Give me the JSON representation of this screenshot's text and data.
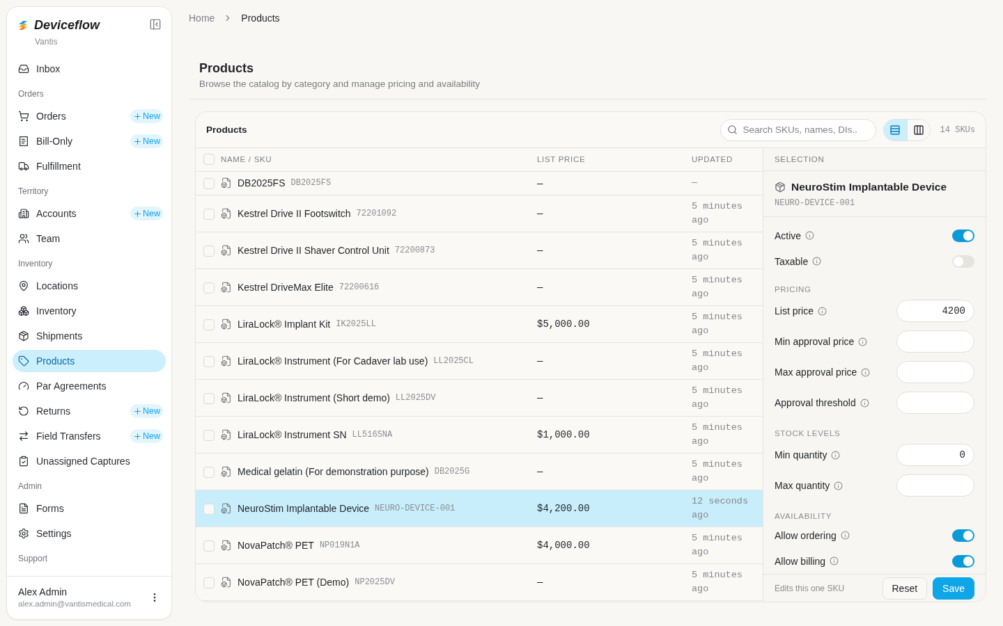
{
  "sidebar": {
    "brand": "Deviceflow",
    "org": "Vantis",
    "nav": [
      {
        "kind": "item",
        "label": "Inbox",
        "selected": false
      },
      {
        "kind": "section",
        "label": "Orders"
      },
      {
        "kind": "item",
        "label": "Orders",
        "badge": "New",
        "selected": false
      },
      {
        "kind": "item",
        "label": "Bill-Only",
        "badge": "New",
        "selected": false
      },
      {
        "kind": "item",
        "label": "Fulfillment",
        "selected": false
      },
      {
        "kind": "section",
        "label": "Territory"
      },
      {
        "kind": "item",
        "label": "Accounts",
        "badge": "New",
        "selected": false
      },
      {
        "kind": "item",
        "label": "Team",
        "selected": false
      },
      {
        "kind": "section",
        "label": "Inventory"
      },
      {
        "kind": "item",
        "label": "Locations",
        "selected": false
      },
      {
        "kind": "item",
        "label": "Inventory",
        "selected": false
      },
      {
        "kind": "item",
        "label": "Shipments",
        "selected": false
      },
      {
        "kind": "item",
        "label": "Products",
        "selected": true
      },
      {
        "kind": "item",
        "label": "Par Agreements",
        "selected": false
      },
      {
        "kind": "item",
        "label": "Returns",
        "badge": "New",
        "selected": false
      },
      {
        "kind": "item",
        "label": "Field Transfers",
        "badge": "New",
        "selected": false
      },
      {
        "kind": "item",
        "label": "Unassigned Captures",
        "selected": false
      },
      {
        "kind": "section",
        "label": "Admin"
      },
      {
        "kind": "item",
        "label": "Forms",
        "selected": false
      },
      {
        "kind": "item",
        "label": "Settings",
        "selected": false
      },
      {
        "kind": "section",
        "label": "Support"
      }
    ],
    "user": {
      "name": "Alex Admin",
      "email": "alex.admin@vantismedical.com"
    }
  },
  "breadcrumb": [
    "Home",
    "Products"
  ],
  "page": {
    "title": "Products",
    "subtitle": "Browse the catalog by category and manage pricing and availability"
  },
  "panel": {
    "title": "Products",
    "search": {
      "placeholder": "Search SKUs, names, DIs.."
    },
    "views": [
      {
        "kind": "list",
        "selected": true
      },
      {
        "kind": "columns",
        "selected": false
      }
    ],
    "count": "14 SKUs",
    "table": {
      "header_checked": false,
      "columns": [
        "NAME / SKU",
        "LIST PRICE",
        "UPDATED"
      ],
      "rows": [
        {
          "name": "DB2025FS",
          "sku": "DB2025FS",
          "price": "—",
          "updated": "—",
          "checked": false,
          "selected": false
        },
        {
          "name": "Kestrel Drive II Footswitch",
          "sku": "72201092",
          "price": "—",
          "updated": "5 minutes ago",
          "checked": false,
          "selected": false
        },
        {
          "name": "Kestrel Drive II Shaver Control Unit",
          "sku": "72200873",
          "price": "—",
          "updated": "5 minutes ago",
          "checked": false,
          "selected": false
        },
        {
          "name": "Kestrel DriveMax Elite",
          "sku": "72200616",
          "price": "—",
          "updated": "5 minutes ago",
          "checked": false,
          "selected": false
        },
        {
          "name": "LiraLock® Implant Kit",
          "sku": "IK2025LL",
          "price": "$5,000.00",
          "updated": "5 minutes ago",
          "checked": false,
          "selected": false
        },
        {
          "name": "LiraLock® Instrument (For Cadaver lab use)",
          "sku": "LL2025CL",
          "price": "—",
          "updated": "5 minutes ago",
          "checked": false,
          "selected": false
        },
        {
          "name": "LiraLock® Instrument (Short demo)",
          "sku": "LL2025DV",
          "price": "—",
          "updated": "5 minutes ago",
          "checked": false,
          "selected": false
        },
        {
          "name": "LiraLock® Instrument SN",
          "sku": "LL516SNA",
          "price": "$1,000.00",
          "updated": "5 minutes ago",
          "checked": false,
          "selected": false
        },
        {
          "name": "Medical gelatin (For demonstration purpose)",
          "sku": "DB2025G",
          "price": "—",
          "updated": "5 minutes ago",
          "checked": false,
          "selected": false
        },
        {
          "name": "NeuroStim Implantable Device",
          "sku": "NEURO-DEVICE-001",
          "price": "$4,200.00",
          "updated": "12 seconds ago",
          "checked": false,
          "selected": true
        },
        {
          "name": "NovaPatch® PET",
          "sku": "NP019N1A",
          "price": "$4,000.00",
          "updated": "5 minutes ago",
          "checked": false,
          "selected": false
        },
        {
          "name": "NovaPatch® PET (Demo)",
          "sku": "NP2025DV",
          "price": "—",
          "updated": "5 minutes ago",
          "checked": false,
          "selected": false
        }
      ]
    },
    "selection": {
      "heading": "SELECTION",
      "name": "NeuroStim Implantable Device",
      "sku": "NEURO-DEVICE-001",
      "fields": [
        {
          "kind": "toggle",
          "label": "Active",
          "on": true
        },
        {
          "kind": "toggle",
          "label": "Taxable",
          "on": false
        },
        {
          "kind": "section",
          "label": "PRICING"
        },
        {
          "kind": "input",
          "label": "List price",
          "value": "4200"
        },
        {
          "kind": "input",
          "label": "Min approval price"
        },
        {
          "kind": "input",
          "label": "Max approval price"
        },
        {
          "kind": "input",
          "label": "Approval threshold"
        },
        {
          "kind": "section",
          "label": "STOCK LEVELS"
        },
        {
          "kind": "input",
          "label": "Min quantity",
          "value": "0"
        },
        {
          "kind": "input",
          "label": "Max quantity"
        },
        {
          "kind": "section",
          "label": "AVAILABILITY"
        },
        {
          "kind": "toggle",
          "label": "Allow ordering",
          "on": true
        },
        {
          "kind": "toggle",
          "label": "Allow billing",
          "on": true
        }
      ],
      "note": "Edits this one SKU",
      "buttons": [
        {
          "kind": "secondary",
          "label": "Reset"
        },
        {
          "kind": "primary",
          "label": "Save"
        }
      ]
    }
  }
}
